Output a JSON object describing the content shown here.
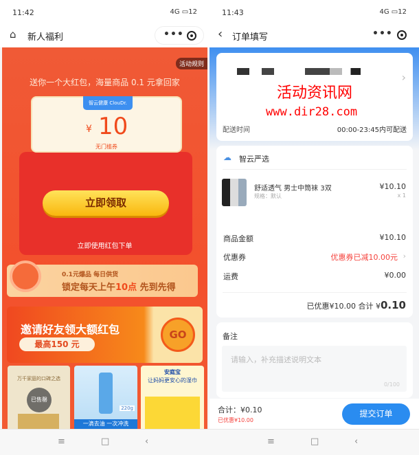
{
  "left": {
    "status": {
      "time": "11:42",
      "signal": "4G",
      "battery": "12"
    },
    "nav": {
      "title": "新人福利",
      "icon": "home-icon"
    },
    "rules_label": "活动规则",
    "headline": "送你一个大红包，海量商品 0.1 元拿回家",
    "coupon": {
      "brand": "智云健康 ClouDr.",
      "currency": "¥",
      "amount": "10",
      "desc": "无门槛券"
    },
    "claim_button": "立即领取",
    "use_hint": "立即使用红包下单",
    "daily_banner": {
      "line1": "0.1元爆品 每日供货",
      "line2_pre": "锁定每天上午",
      "line2_hl": "10点",
      "line2_post": " 先到先得"
    },
    "invite_banner": {
      "title": "邀请好友领大额红包",
      "sub": "最高150 元",
      "go": "GO"
    },
    "products": [
      {
        "caption": "万千家庭的口碑之选",
        "badge": "已售罄"
      },
      {
        "caption": "一滴去油 一次冲洗",
        "tag": "220g"
      },
      {
        "brand": "安庭宝",
        "caption": "让妈妈更安心的湿巾"
      }
    ]
  },
  "right": {
    "status": {
      "time": "11:43",
      "signal": "4G",
      "battery": "12"
    },
    "nav": {
      "title": "订单填写"
    },
    "watermark": {
      "line1": "活动资讯网",
      "line2": "www.dir28.com"
    },
    "delivery": {
      "label": "配送时间",
      "value": "00:00-23:45内可配送"
    },
    "store": "智云严选",
    "item": {
      "name": "舒适透气 男士中筒袜 3双",
      "spec": "规格：默认",
      "price": "¥10.10",
      "qty": "x 1"
    },
    "fees": [
      {
        "label": "商品金额",
        "value": "¥10.10"
      },
      {
        "label": "优惠券",
        "value": "优惠券已减10.00元"
      },
      {
        "label": "运费",
        "value": "¥0.00"
      }
    ],
    "summary": {
      "discount": "已优惠¥10.00 合计",
      "currency": "¥",
      "total": "0.10"
    },
    "remark": {
      "label": "备注",
      "placeholder": "请输入，补充描述说明文本",
      "counter": "0/100"
    },
    "footer": {
      "total": "合计：¥0.10",
      "discount": "已优惠¥10.00",
      "submit": "提交订单"
    },
    "colors": {
      "accent": "#2a8cf0",
      "discount": "#f5423c",
      "page_red": "#f3502c"
    }
  }
}
